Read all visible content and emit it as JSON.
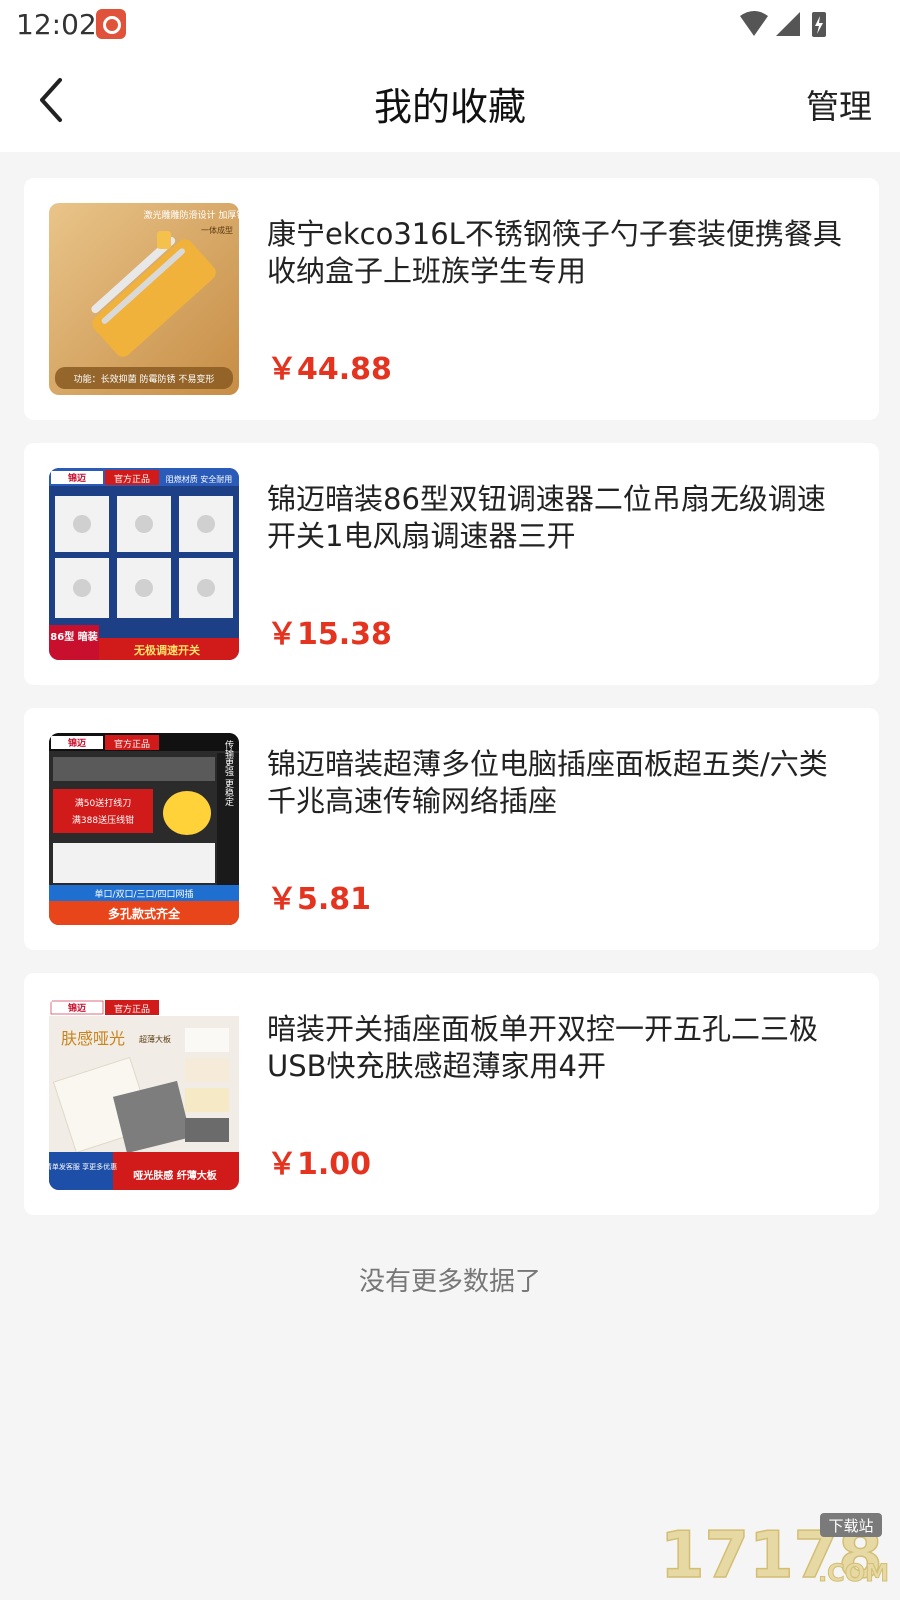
{
  "status": {
    "time": "12:02"
  },
  "header": {
    "title": "我的收藏",
    "manage_label": "管理"
  },
  "favorites": [
    {
      "title": "康宁ekco316L不锈钢筷子勺子套装便携餐具收纳盒子上班族学生专用",
      "price": "￥44.88",
      "image_text": {
        "top": "激光雕雕防滑设计 加厚钢材",
        "sub": "一体成型",
        "bottom": "功能：长效抑菌 防霉防锈 不易变形"
      }
    },
    {
      "title": "锦迈暗装86型双钮调速器二位吊扇无级调速开关1电风扇调速器三开",
      "price": "￥15.38",
      "image_text": {
        "brand": "锦迈",
        "tag": "官方正品",
        "tag2": "阻燃材质 安全耐用",
        "side": "86型 暗装",
        "bottom": "无极调速开关"
      }
    },
    {
      "title": "锦迈暗装超薄多位电脑插座面板超五类/六类千兆高速传输网络插座",
      "price": "￥5.81",
      "image_text": {
        "brand": "锦迈",
        "tag": "官方正品",
        "promo1": "满50送打线刀",
        "promo2": "满388送压线钳",
        "side": "传输更强 更稳定",
        "strip": "单口/双口/三口/四口网插",
        "bottom": "多孔款式齐全"
      }
    },
    {
      "title": "暗装开关插座面板单开双控一开五孔二三极USB快充肤感超薄家用4开",
      "price": "￥1.00",
      "image_text": {
        "brand": "锦迈",
        "tag": "官方正品",
        "headline": "肤感哑光",
        "badge": "超薄大板",
        "left": "清单发客服 享更多优惠",
        "right": "哑光肤感 纤薄大板"
      }
    }
  ],
  "footer": {
    "no_more": "没有更多数据了"
  },
  "watermark": {
    "text": "17178",
    "tag": "下载站",
    "suffix": ".COM"
  }
}
